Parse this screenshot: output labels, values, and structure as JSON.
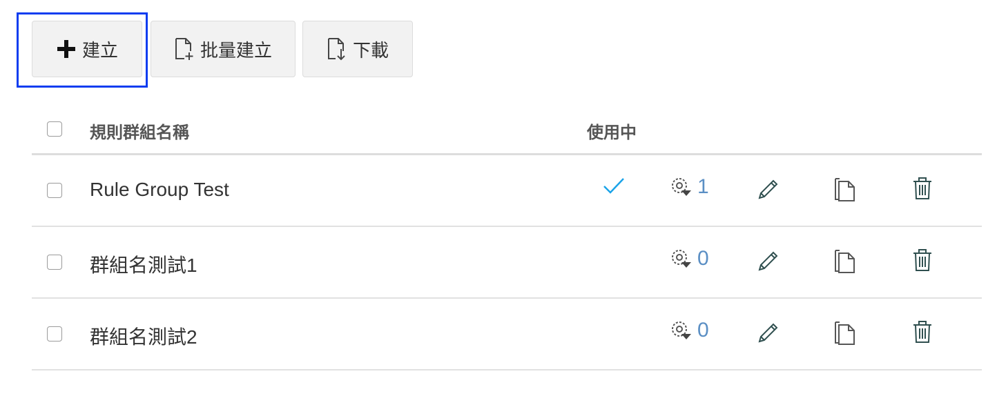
{
  "toolbar": {
    "create_label": "建立",
    "bulk_create_label": "批量建立",
    "download_label": "下載"
  },
  "table": {
    "headers": {
      "name": "規則群組名稱",
      "in_use": "使用中"
    },
    "rows": [
      {
        "name": "Rule Group Test",
        "in_use": true,
        "rule_count": "1"
      },
      {
        "name": "群組名測試1",
        "in_use": false,
        "rule_count": "0"
      },
      {
        "name": "群組名測試2",
        "in_use": false,
        "rule_count": "0"
      }
    ]
  },
  "colors": {
    "accent_check": "#1aa3e8",
    "count_link": "#5b8fc4",
    "focus_ring": "#0a3cf0",
    "action_icon": "#2f4f4f"
  },
  "icons": [
    "plus-icon",
    "file-add-icon",
    "file-download-icon",
    "checkmark-icon",
    "gear-rules-icon",
    "pencil-icon",
    "copy-icon",
    "trash-icon"
  ]
}
